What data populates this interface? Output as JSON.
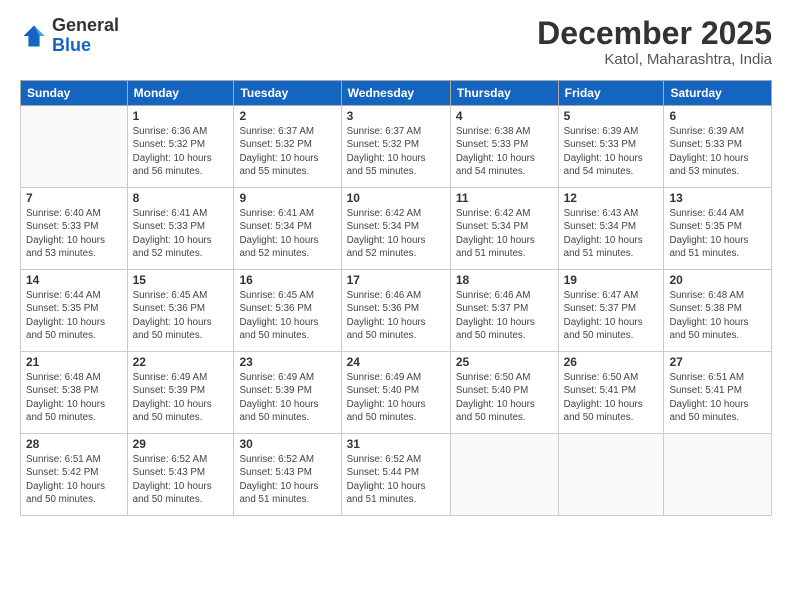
{
  "header": {
    "logo_general": "General",
    "logo_blue": "Blue",
    "month_year": "December 2025",
    "location": "Katol, Maharashtra, India"
  },
  "columns": [
    "Sunday",
    "Monday",
    "Tuesday",
    "Wednesday",
    "Thursday",
    "Friday",
    "Saturday"
  ],
  "weeks": [
    [
      {
        "day": "",
        "info": ""
      },
      {
        "day": "1",
        "info": "Sunrise: 6:36 AM\nSunset: 5:32 PM\nDaylight: 10 hours\nand 56 minutes."
      },
      {
        "day": "2",
        "info": "Sunrise: 6:37 AM\nSunset: 5:32 PM\nDaylight: 10 hours\nand 55 minutes."
      },
      {
        "day": "3",
        "info": "Sunrise: 6:37 AM\nSunset: 5:32 PM\nDaylight: 10 hours\nand 55 minutes."
      },
      {
        "day": "4",
        "info": "Sunrise: 6:38 AM\nSunset: 5:33 PM\nDaylight: 10 hours\nand 54 minutes."
      },
      {
        "day": "5",
        "info": "Sunrise: 6:39 AM\nSunset: 5:33 PM\nDaylight: 10 hours\nand 54 minutes."
      },
      {
        "day": "6",
        "info": "Sunrise: 6:39 AM\nSunset: 5:33 PM\nDaylight: 10 hours\nand 53 minutes."
      }
    ],
    [
      {
        "day": "7",
        "info": "Sunrise: 6:40 AM\nSunset: 5:33 PM\nDaylight: 10 hours\nand 53 minutes."
      },
      {
        "day": "8",
        "info": "Sunrise: 6:41 AM\nSunset: 5:33 PM\nDaylight: 10 hours\nand 52 minutes."
      },
      {
        "day": "9",
        "info": "Sunrise: 6:41 AM\nSunset: 5:34 PM\nDaylight: 10 hours\nand 52 minutes."
      },
      {
        "day": "10",
        "info": "Sunrise: 6:42 AM\nSunset: 5:34 PM\nDaylight: 10 hours\nand 52 minutes."
      },
      {
        "day": "11",
        "info": "Sunrise: 6:42 AM\nSunset: 5:34 PM\nDaylight: 10 hours\nand 51 minutes."
      },
      {
        "day": "12",
        "info": "Sunrise: 6:43 AM\nSunset: 5:34 PM\nDaylight: 10 hours\nand 51 minutes."
      },
      {
        "day": "13",
        "info": "Sunrise: 6:44 AM\nSunset: 5:35 PM\nDaylight: 10 hours\nand 51 minutes."
      }
    ],
    [
      {
        "day": "14",
        "info": "Sunrise: 6:44 AM\nSunset: 5:35 PM\nDaylight: 10 hours\nand 50 minutes."
      },
      {
        "day": "15",
        "info": "Sunrise: 6:45 AM\nSunset: 5:36 PM\nDaylight: 10 hours\nand 50 minutes."
      },
      {
        "day": "16",
        "info": "Sunrise: 6:45 AM\nSunset: 5:36 PM\nDaylight: 10 hours\nand 50 minutes."
      },
      {
        "day": "17",
        "info": "Sunrise: 6:46 AM\nSunset: 5:36 PM\nDaylight: 10 hours\nand 50 minutes."
      },
      {
        "day": "18",
        "info": "Sunrise: 6:46 AM\nSunset: 5:37 PM\nDaylight: 10 hours\nand 50 minutes."
      },
      {
        "day": "19",
        "info": "Sunrise: 6:47 AM\nSunset: 5:37 PM\nDaylight: 10 hours\nand 50 minutes."
      },
      {
        "day": "20",
        "info": "Sunrise: 6:48 AM\nSunset: 5:38 PM\nDaylight: 10 hours\nand 50 minutes."
      }
    ],
    [
      {
        "day": "21",
        "info": "Sunrise: 6:48 AM\nSunset: 5:38 PM\nDaylight: 10 hours\nand 50 minutes."
      },
      {
        "day": "22",
        "info": "Sunrise: 6:49 AM\nSunset: 5:39 PM\nDaylight: 10 hours\nand 50 minutes."
      },
      {
        "day": "23",
        "info": "Sunrise: 6:49 AM\nSunset: 5:39 PM\nDaylight: 10 hours\nand 50 minutes."
      },
      {
        "day": "24",
        "info": "Sunrise: 6:49 AM\nSunset: 5:40 PM\nDaylight: 10 hours\nand 50 minutes."
      },
      {
        "day": "25",
        "info": "Sunrise: 6:50 AM\nSunset: 5:40 PM\nDaylight: 10 hours\nand 50 minutes."
      },
      {
        "day": "26",
        "info": "Sunrise: 6:50 AM\nSunset: 5:41 PM\nDaylight: 10 hours\nand 50 minutes."
      },
      {
        "day": "27",
        "info": "Sunrise: 6:51 AM\nSunset: 5:41 PM\nDaylight: 10 hours\nand 50 minutes."
      }
    ],
    [
      {
        "day": "28",
        "info": "Sunrise: 6:51 AM\nSunset: 5:42 PM\nDaylight: 10 hours\nand 50 minutes."
      },
      {
        "day": "29",
        "info": "Sunrise: 6:52 AM\nSunset: 5:43 PM\nDaylight: 10 hours\nand 50 minutes."
      },
      {
        "day": "30",
        "info": "Sunrise: 6:52 AM\nSunset: 5:43 PM\nDaylight: 10 hours\nand 51 minutes."
      },
      {
        "day": "31",
        "info": "Sunrise: 6:52 AM\nSunset: 5:44 PM\nDaylight: 10 hours\nand 51 minutes."
      },
      {
        "day": "",
        "info": ""
      },
      {
        "day": "",
        "info": ""
      },
      {
        "day": "",
        "info": ""
      }
    ]
  ]
}
